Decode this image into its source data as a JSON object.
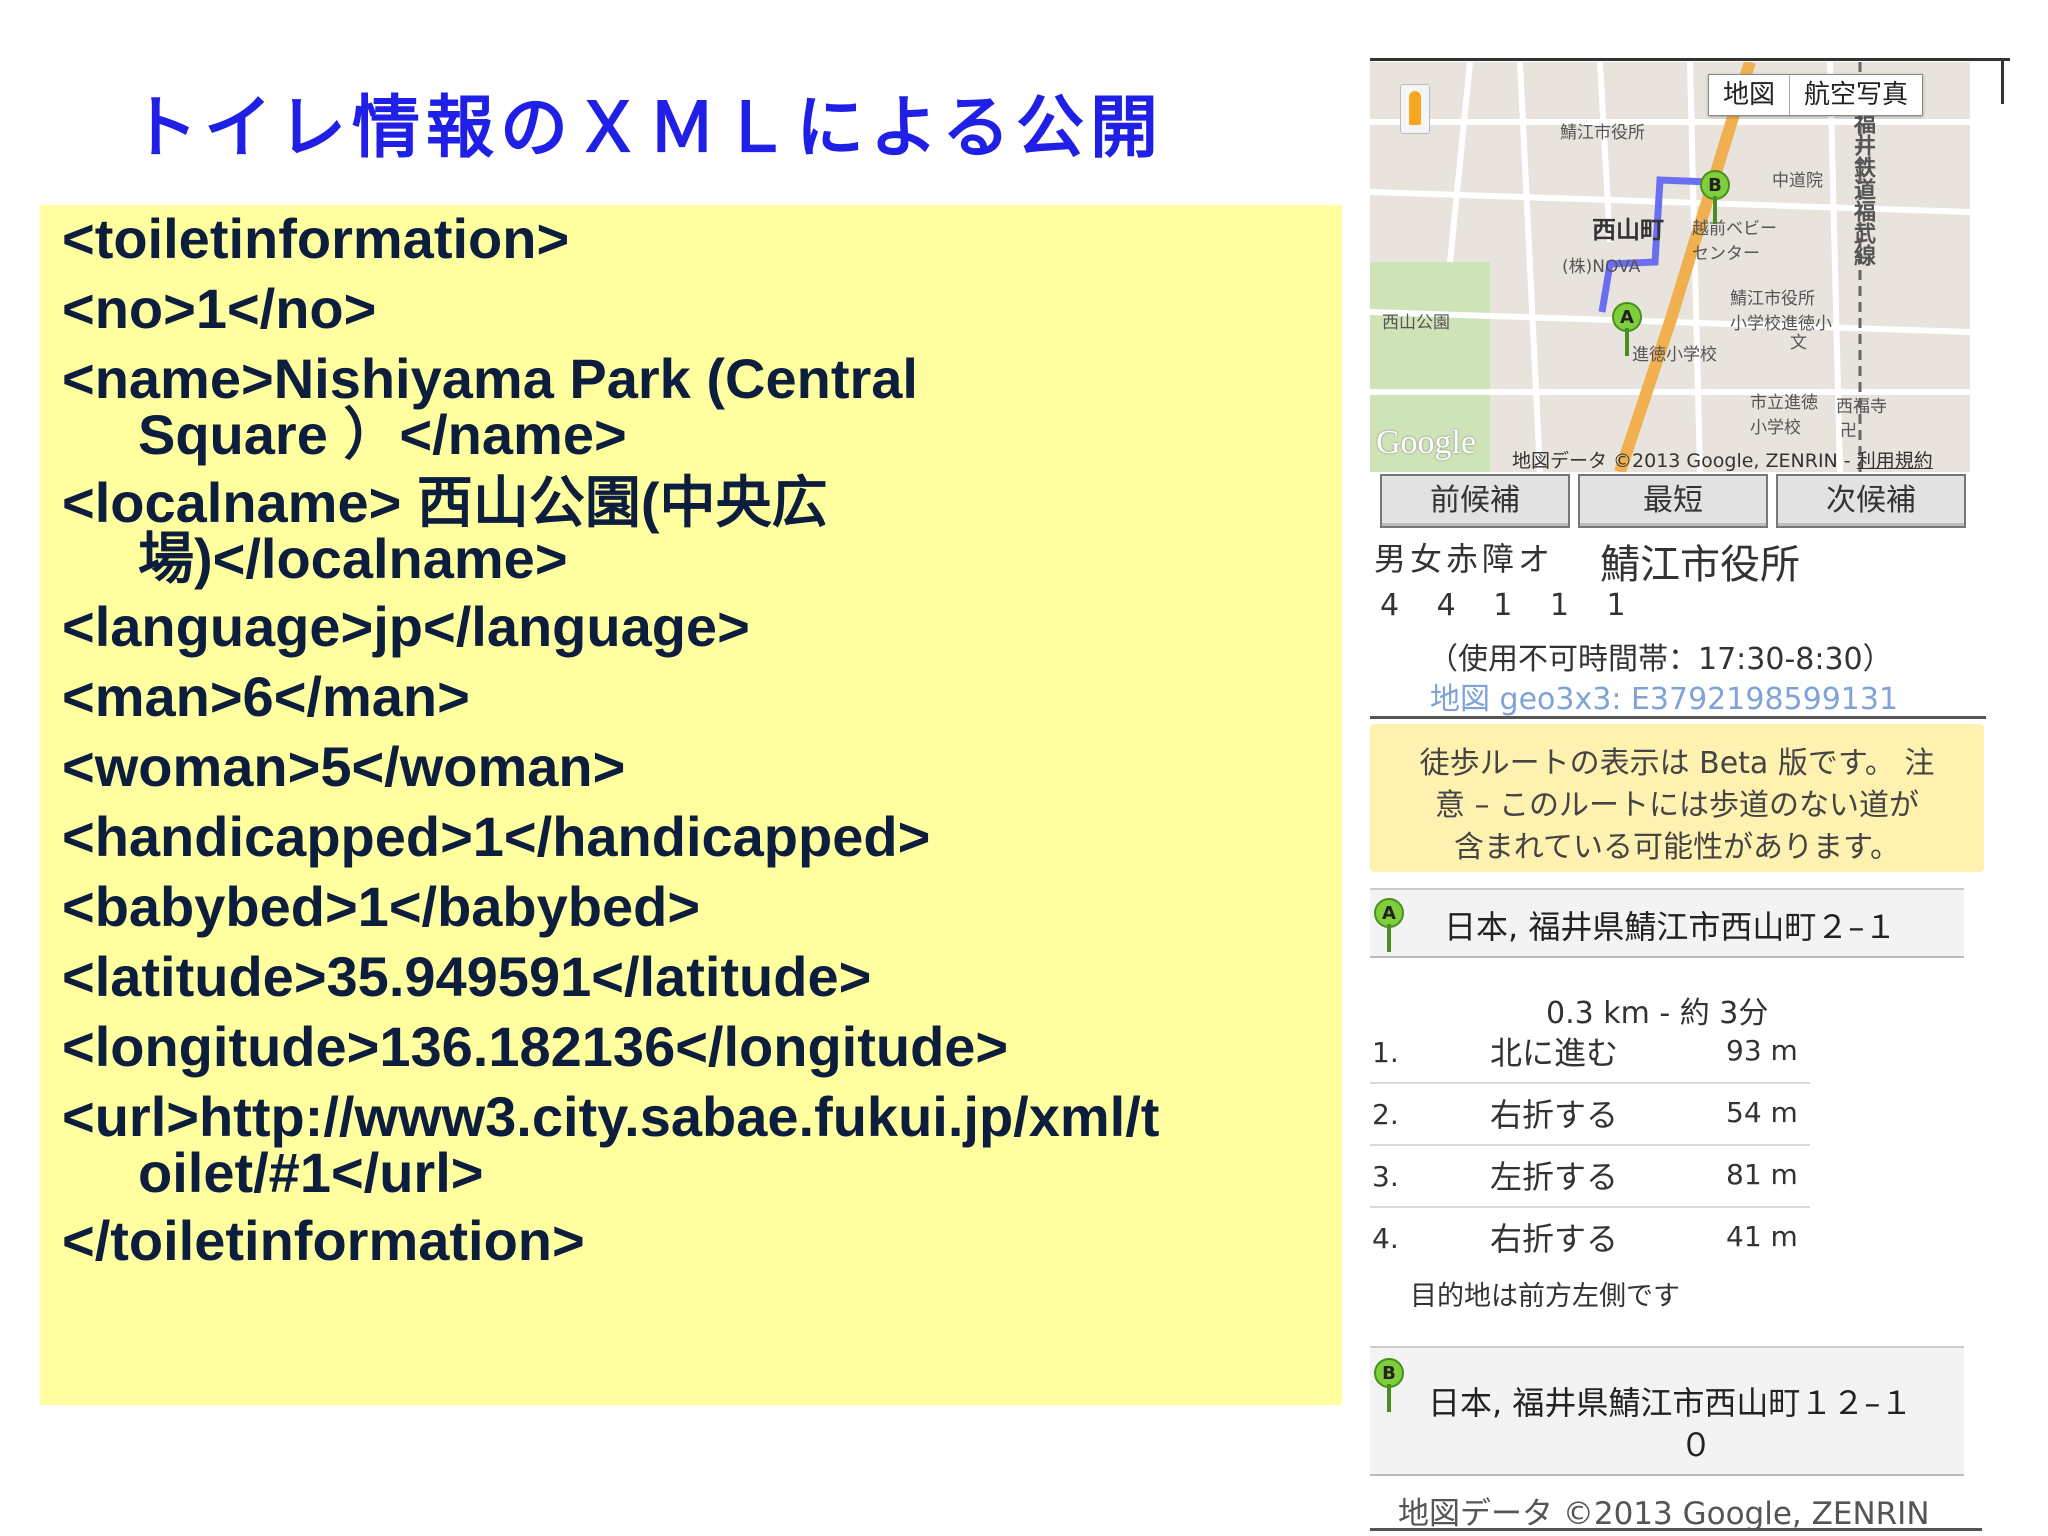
{
  "slide": {
    "title": "トイレ情報のＸＭＬによる公開"
  },
  "xml_lines": [
    "<toiletinformation>",
    "<no>1</no>",
    "<name>Nishiyama Park (Central",
    "Square ）</name>",
    "<localname> 西山公園(中央広",
    "場)</localname>",
    "<language>jp</language>",
    "<man>6</man>",
    "<woman>5</woman>",
    "<handicapped>1</handicapped>",
    "<babybed>1</babybed>",
    "<latitude>35.949591</latitude>",
    "<longitude>136.182136</longitude>",
    "<url>http://www3.city.sabae.fukui.jp/xml/t",
    "oilet/#1</url>",
    "</toiletinformation>"
  ],
  "map": {
    "type_buttons": [
      "地図",
      "航空写真"
    ],
    "labels": {
      "city_hall": "鯖江市役所",
      "nishiyama": "西山町",
      "baby_center": "越前ベビー\nセンター",
      "nova": "(株)NOVA",
      "nishiyama_park": "西山公園",
      "city_school": "鯖江市役所\n小学校進徳小",
      "bun": "文",
      "school": "進徳小学校",
      "elementary": "市立進徳\n小学校",
      "temple": "西福寺",
      "temple_symbol": "卍",
      "hospital": "中道院",
      "rail": "福井鉄道福武線"
    },
    "google_logo": "Google",
    "attribution": "地図データ ©2013 Google, ZENRIN - ",
    "terms": "利用規約",
    "marker_a": "A",
    "marker_b": "B"
  },
  "nav_buttons": [
    "前候補",
    "最短",
    "次候補"
  ],
  "toilet_info": {
    "icons": "男女赤障オ",
    "place": "鯖江市役所",
    "counts": "4 4 1 1 1",
    "hours": "（使用不可時間帯：17:30-8:30）",
    "link": "地図 geo3x3: E3792198599131"
  },
  "notice": [
    "徒歩ルートの表示は Beta 版です。 注",
    "意 – このルートには歩道のない道が",
    "含まれている可能性があります。"
  ],
  "route": {
    "start_marker": "A",
    "start_address": "日本, 福井県鯖江市西山町２–１",
    "summary": "0.3 km - 約 3分",
    "steps": [
      {
        "num": "1.",
        "text": "北に進む",
        "dist": "93 m"
      },
      {
        "num": "2.",
        "text": "右折する",
        "dist": "54 m"
      },
      {
        "num": "3.",
        "text": "左折する",
        "dist": "81 m"
      },
      {
        "num": "4.",
        "text": "右折する",
        "dist": "41 m"
      }
    ],
    "destination_note": "目的地は前方左側です",
    "end_marker": "B",
    "end_address_line1": "日本, 福井県鯖江市西山町１２–１",
    "end_address_line2": "０"
  },
  "footer": "地図データ ©2013 Google, ZENRIN",
  "colors": {
    "title": "#1f1fe6",
    "xml_box": "#ffff9f",
    "xml_text": "#0d1d3d",
    "notice_bg": "#fff1b0",
    "link": "#7fa3d8",
    "route_line": "#6b6ef0",
    "highway": "#f0b050"
  }
}
